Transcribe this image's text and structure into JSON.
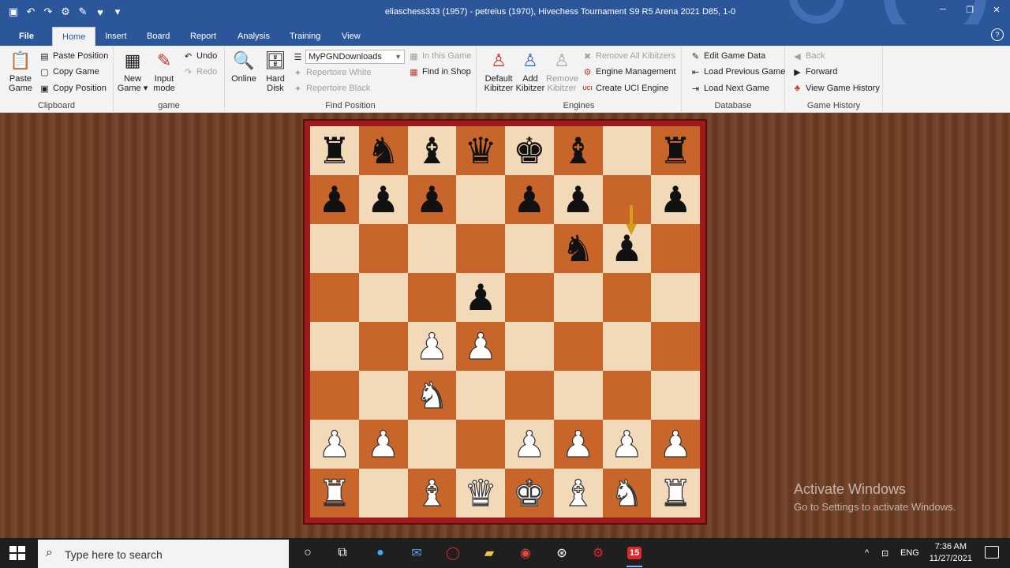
{
  "window": {
    "title": "eliaschess333 (1957) - petreius (1970), Hivechess Tournament S9 R5 Arena 2021  D85, 1-0"
  },
  "tabs": {
    "file": "File",
    "items": [
      "Home",
      "Insert",
      "Board",
      "Report",
      "Analysis",
      "Training",
      "View"
    ],
    "active": "Home"
  },
  "ribbon": {
    "clipboard": {
      "paste_game": [
        "Paste",
        "Game"
      ],
      "paste_position": "Paste Position",
      "copy_game": "Copy Game",
      "copy_position": "Copy Position",
      "label": "Clipboard"
    },
    "game": {
      "new_game": [
        "New",
        "Game"
      ],
      "input_mode": [
        "Input",
        "mode"
      ],
      "undo": "Undo",
      "redo": "Redo",
      "label": "game"
    },
    "find_position": {
      "online": "Online",
      "hard_disk": [
        "Hard",
        "Disk"
      ],
      "database_value": "MyPGNDownloads",
      "repertoire_white": "Repertoire White",
      "repertoire_black": "Repertoire Black",
      "in_this_game": "In this Game",
      "find_in_shop": "Find in Shop",
      "label": "Find Position"
    },
    "engines": {
      "default_kibitzer": [
        "Default",
        "Kibitzer"
      ],
      "add_kibitzer": [
        "Add",
        "Kibitzer"
      ],
      "remove_kibitzer": [
        "Remove",
        "Kibitzer"
      ],
      "remove_all_kibitzers": "Remove All Kibitzers",
      "engine_management": "Engine Management",
      "create_uci_engine": "Create UCI Engine",
      "uci_badge": "UCI",
      "label": "Engines"
    },
    "database": {
      "edit_game_data": "Edit Game Data",
      "load_previous_game": "Load Previous Game",
      "load_next_game": "Load Next Game",
      "label": "Database"
    },
    "game_history": {
      "back": "Back",
      "forward": "Forward",
      "view_game_history": "View Game History",
      "label": "Game History"
    }
  },
  "board": {
    "orientation": "white-bottom",
    "ranks": [
      [
        "bR",
        "bN",
        "bB",
        "bQ",
        "bK",
        "bB",
        "",
        "bR"
      ],
      [
        "bP",
        "bP",
        "bP",
        "",
        "bP",
        "bP",
        "",
        "bP"
      ],
      [
        "",
        "",
        "",
        "",
        "",
        "bN",
        "bP",
        ""
      ],
      [
        "",
        "",
        "",
        "bP",
        "",
        "",
        "",
        ""
      ],
      [
        "",
        "",
        "wP",
        "wP",
        "",
        "",
        "",
        ""
      ],
      [
        "",
        "",
        "wN",
        "",
        "",
        "",
        "",
        ""
      ],
      [
        "wP",
        "wP",
        "",
        "",
        "wP",
        "wP",
        "wP",
        "wP"
      ],
      [
        "wR",
        "",
        "wB",
        "wQ",
        "wK",
        "wB",
        "wN",
        "wR"
      ]
    ],
    "last_move": "g7-g6",
    "arrow_color": "#d4a017"
  },
  "watermark": {
    "line1": "Activate Windows",
    "line2": "Go to Settings to activate Windows."
  },
  "taskbar": {
    "search_placeholder": "Type here to search",
    "language": "ENG",
    "time": "7:36 AM",
    "date": "11/27/2021",
    "fritz_badge": "15"
  }
}
